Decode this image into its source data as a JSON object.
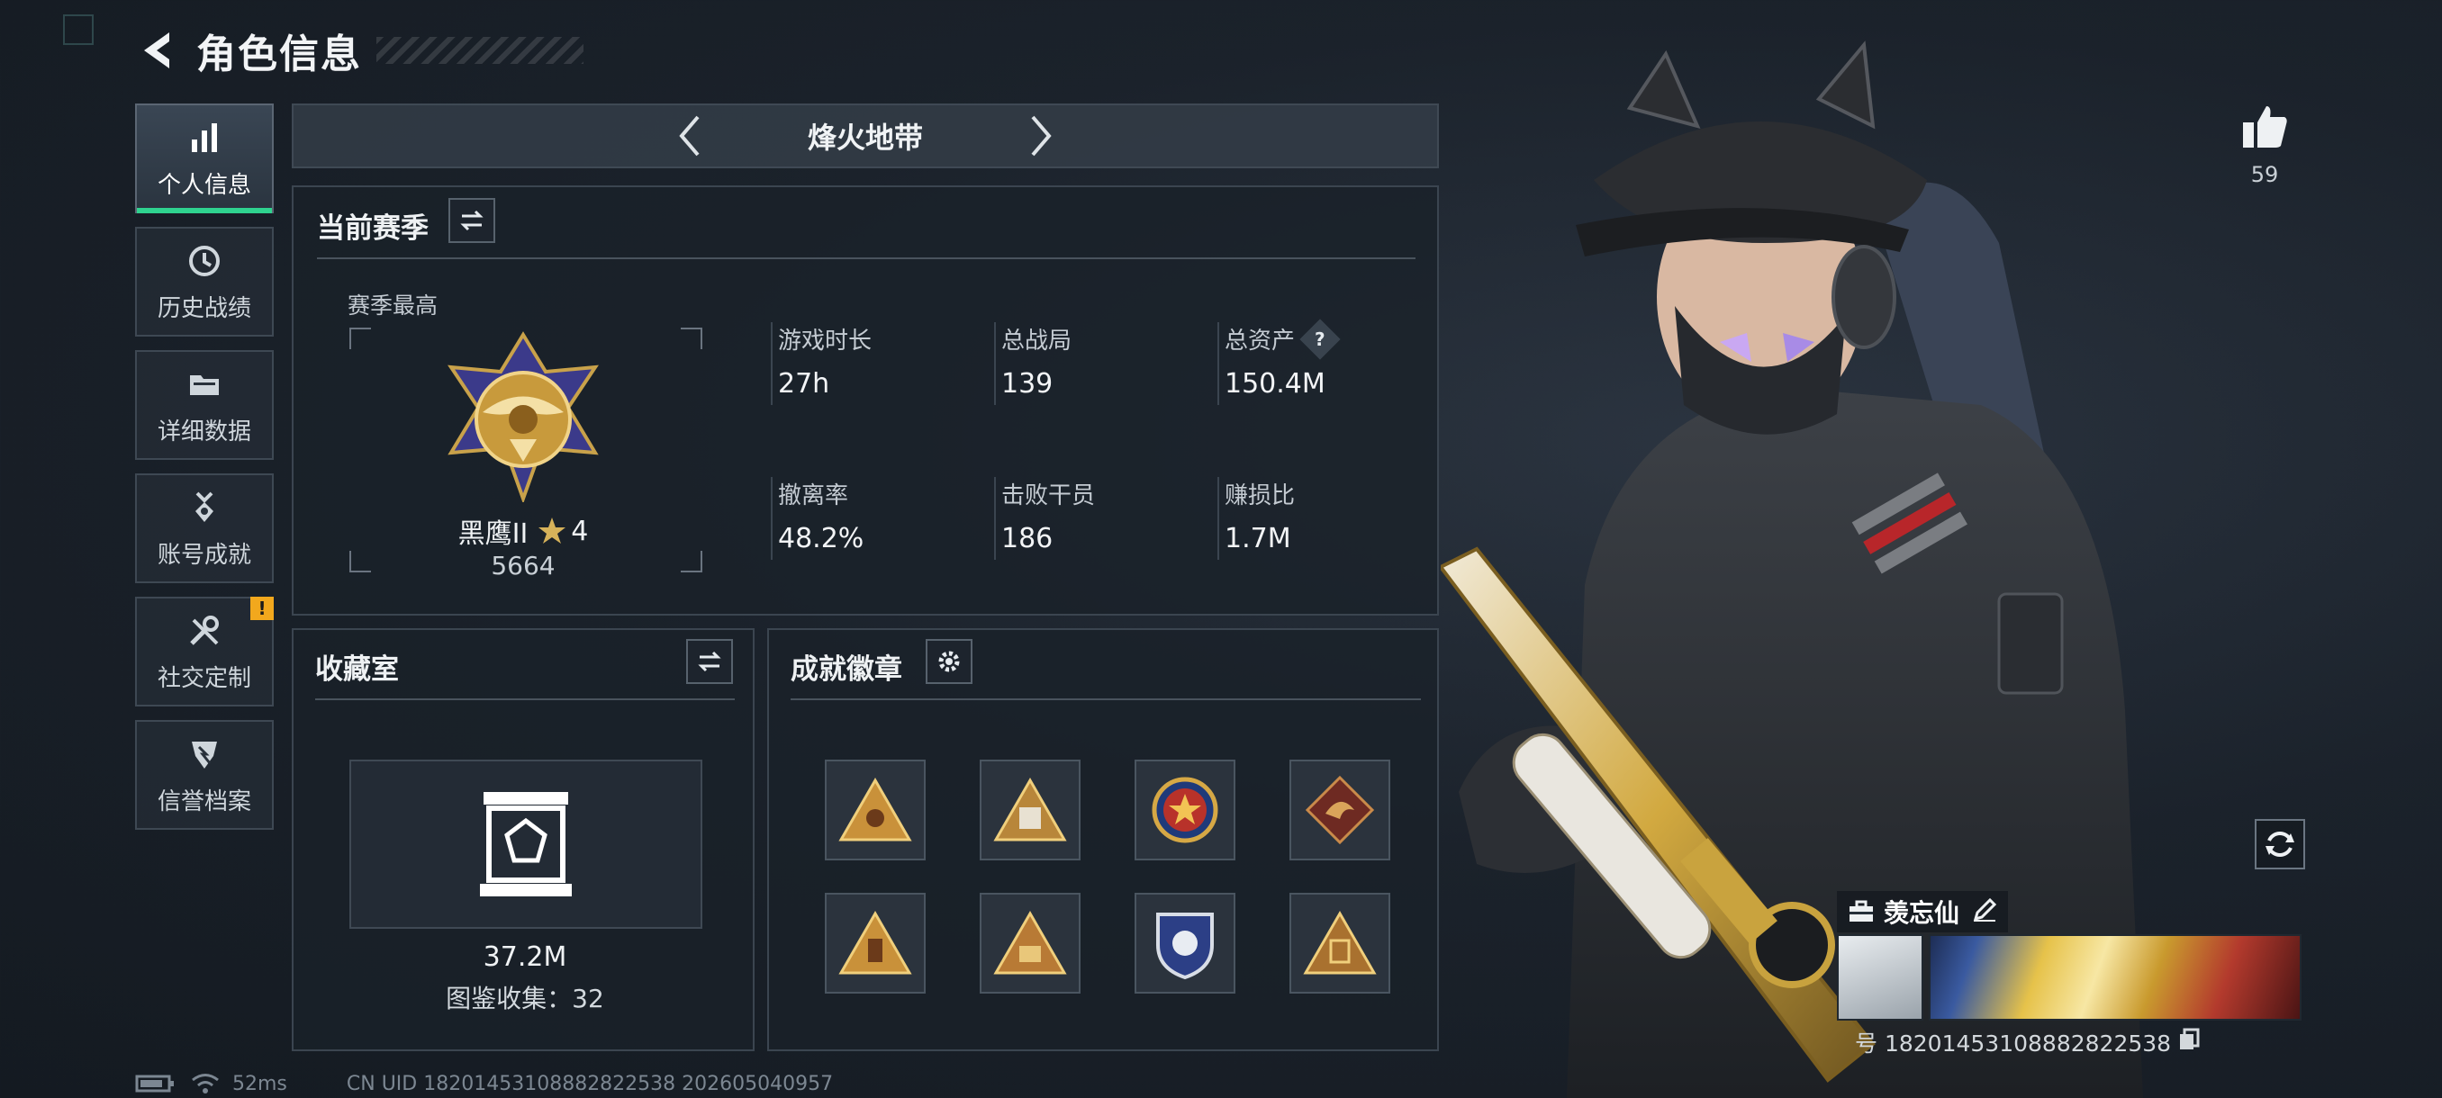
{
  "header": {
    "title": "角色信息"
  },
  "sidebar": {
    "items": [
      {
        "label": "个人信息",
        "icon": "bar-chart-icon",
        "active": true
      },
      {
        "label": "历史战绩",
        "icon": "history-icon"
      },
      {
        "label": "详细数据",
        "icon": "folder-icon"
      },
      {
        "label": "账号成就",
        "icon": "medal-icon"
      },
      {
        "label": "社交定制",
        "icon": "tools-icon",
        "badge": "!"
      },
      {
        "label": "信誉档案",
        "icon": "shield-icon"
      }
    ]
  },
  "mode": {
    "title": "烽火地带"
  },
  "season": {
    "title": "当前赛季",
    "best_label": "赛季最高",
    "rank_name": "黑鹰II",
    "rank_stars": "4",
    "rank_score": "5664",
    "stats": [
      {
        "label": "游戏时长",
        "value": "27h"
      },
      {
        "label": "总战局",
        "value": "139"
      },
      {
        "label": "总资产",
        "value": "150.4M",
        "help": "?"
      },
      {
        "label": "撤离率",
        "value": "48.2%"
      },
      {
        "label": "击败干员",
        "value": "186"
      },
      {
        "label": "赚损比",
        "value": "1.7M"
      }
    ]
  },
  "collection": {
    "title": "收藏室",
    "value": "37.2M",
    "count_text": "图鉴收集：32"
  },
  "achievements": {
    "title": "成就徽章",
    "badge_count": 8
  },
  "profile": {
    "likes": "59",
    "player_name": "羡忘仙",
    "uid_text": "号 18201453108882822538"
  },
  "footer": {
    "ping": "52ms",
    "uid_text": "CN UID 18201453108882822538 202605040957"
  },
  "colors": {
    "accent": "#2fd38f",
    "alert": "#f2a81d",
    "gold": "#d4a13a"
  }
}
